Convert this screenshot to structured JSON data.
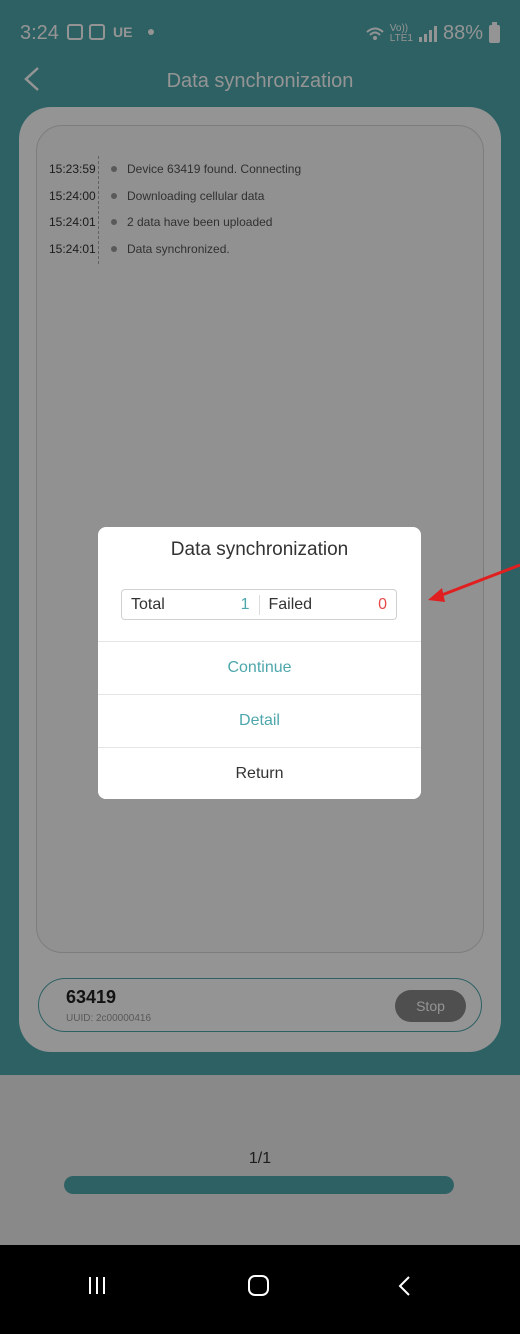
{
  "status_bar": {
    "time": "3:24",
    "carrier": "UE",
    "network_small": "Vo))",
    "network_small2": "LTE1",
    "battery": "88%"
  },
  "nav": {
    "title": "Data synchronization"
  },
  "sync_log": [
    {
      "time": "15:23:59",
      "message": "Device 63419 found. Connecting"
    },
    {
      "time": "15:24:00",
      "message": "Downloading cellular data"
    },
    {
      "time": "15:24:01",
      "message": "2 data have been uploaded"
    },
    {
      "time": "15:24:01",
      "message": "Data synchronized."
    }
  ],
  "device": {
    "name": "63419",
    "uuid": "UUID: 2c00000416",
    "stop_label": "Stop"
  },
  "progress": {
    "label": "1/1",
    "fraction": 1.0
  },
  "dialog": {
    "title": "Data synchronization",
    "total_label": "Total",
    "total_value": "1",
    "failed_label": "Failed",
    "failed_value": "0",
    "continue_label": "Continue",
    "detail_label": "Detail",
    "return_label": "Return"
  },
  "colors": {
    "accent": "#4ea7ac",
    "failed": "#e54b4b",
    "annotation_arrow": "#e02020"
  }
}
